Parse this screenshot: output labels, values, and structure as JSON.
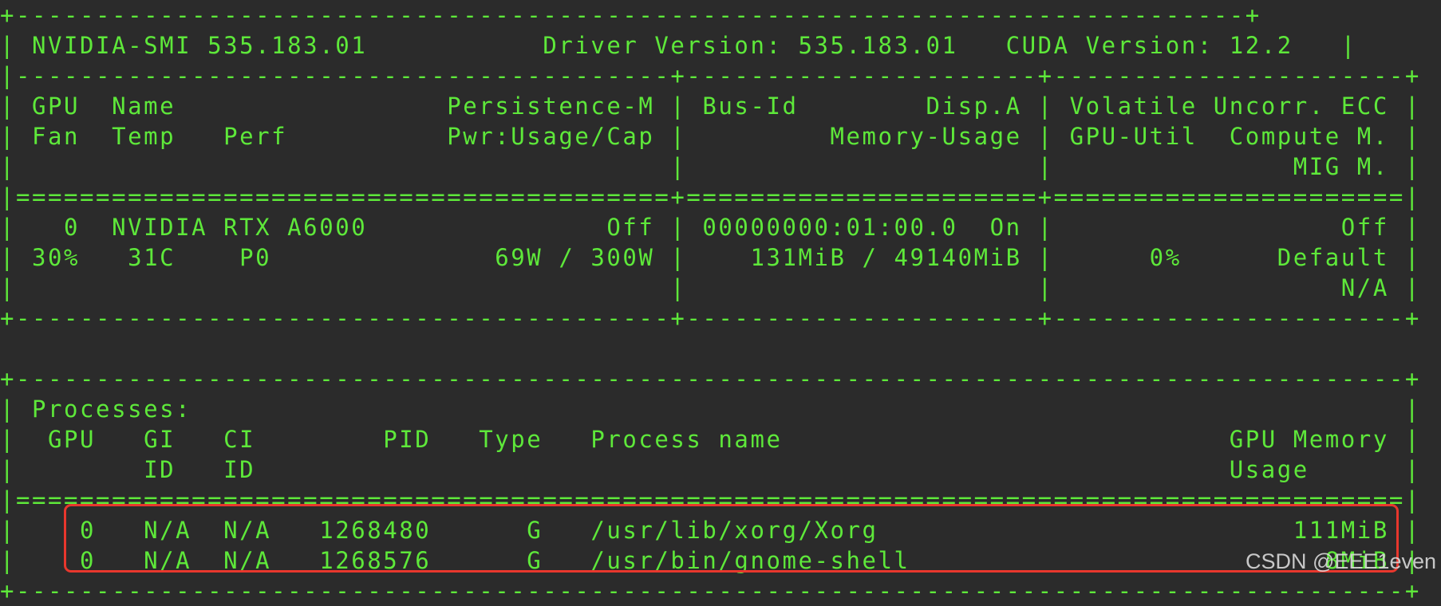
{
  "terminal": {
    "lines": [
      "+-----------------------------------------------------------------------------+",
      "| NVIDIA-SMI 535.183.01           Driver Version: 535.183.01   CUDA Version: 12.2   |",
      "|-----------------------------------------+----------------------+----------------------+",
      "| GPU  Name                 Persistence-M | Bus-Id        Disp.A | Volatile Uncorr. ECC |",
      "| Fan  Temp   Perf          Pwr:Usage/Cap |         Memory-Usage | GPU-Util  Compute M. |",
      "|                                         |                      |               MIG M. |",
      "|=========================================+======================+======================|",
      "|   0  NVIDIA RTX A6000               Off | 00000000:01:00.0  On |                  Off |",
      "| 30%   31C    P0              69W / 300W |    131MiB / 49140MiB |      0%      Default |",
      "|                                         |                      |                  N/A |",
      "+-----------------------------------------+----------------------+----------------------+",
      "",
      "+---------------------------------------------------------------------------------------+",
      "| Processes:                                                                            |",
      "|  GPU   GI   CI        PID   Type   Process name                            GPU Memory |",
      "|        ID   ID                                                             Usage      |",
      "|=======================================================================================|",
      "|    0   N/A  N/A   1268480      G   /usr/lib/xorg/Xorg                          111MiB |",
      "|    0   N/A  N/A   1268576      G   /usr/bin/gnome-shell                          8MiB |",
      "+---------------------------------------------------------------------------------------+"
    ]
  },
  "watermark": "CSDN @EEE1even",
  "colors": {
    "background": "#2b2b2b",
    "text": "#5ee83a",
    "highlight_box": "#e8372d",
    "watermark": "#d9d9d9"
  }
}
